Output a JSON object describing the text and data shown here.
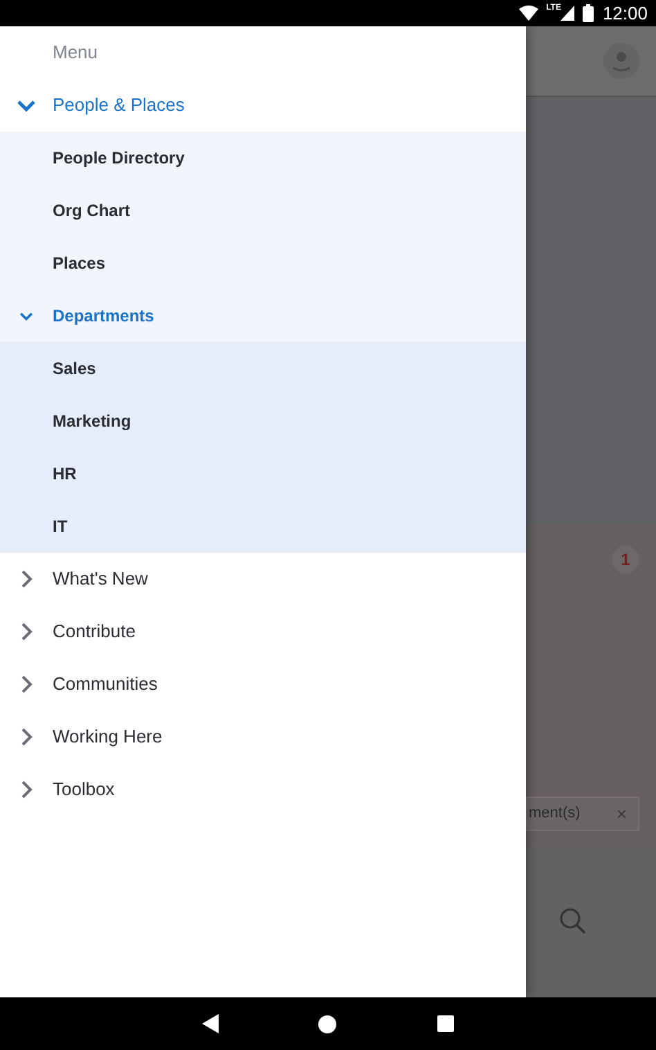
{
  "status_bar": {
    "network": "LTE",
    "time": "12:00"
  },
  "menu": {
    "title": "Menu",
    "items": [
      {
        "label": "People & Places",
        "expanded": true,
        "children": [
          {
            "label": "People Directory"
          },
          {
            "label": "Org Chart"
          },
          {
            "label": "Places"
          },
          {
            "label": "Departments",
            "expanded": true,
            "children": [
              {
                "label": "Sales"
              },
              {
                "label": "Marketing"
              },
              {
                "label": "HR"
              },
              {
                "label": "IT"
              }
            ]
          }
        ]
      },
      {
        "label": "What's New",
        "expanded": false
      },
      {
        "label": "Contribute",
        "expanded": false
      },
      {
        "label": "Communities",
        "expanded": false
      },
      {
        "label": "Working Here",
        "expanded": false
      },
      {
        "label": "Toolbox",
        "expanded": false
      }
    ]
  },
  "background": {
    "badge": "1",
    "chip": {
      "label": "ment(s)",
      "close": "×"
    }
  }
}
